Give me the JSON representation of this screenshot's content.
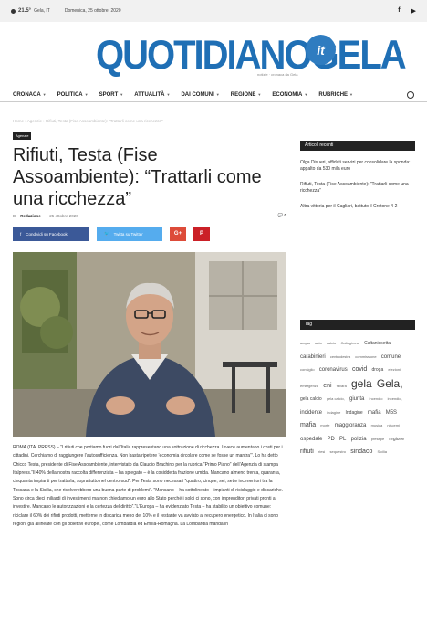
{
  "topbar": {
    "temperature": "21.5°",
    "city": "Gela, IT",
    "date": "Domenica, 25 ottobre, 2020",
    "social_facebook": "f",
    "social_youtube": "▶"
  },
  "logo": {
    "text": "QUOTIDIANOGELA",
    "badge": "it",
    "tagline": "notizie · cronaca da Gela"
  },
  "nav": {
    "items": [
      "CRONACA",
      "POLITICA",
      "SPORT",
      "ATTUALITÀ",
      "DAI COMUNI",
      "REGIONE",
      "ECONOMIA",
      "RUBRICHE"
    ]
  },
  "breadcrumb": "Home  ›  Agenzie  ›  Rifiuti, Testa (Fise Assoambiente): “Trattarli come una ricchezza”",
  "article": {
    "category": "Agenzie",
    "title": "Rifiuti, Testa (Fise Assoambiente): “Trattarli come una ricchezza”",
    "author_prefix": "Di",
    "author": "Redazione",
    "date": "25 ottobre 2020",
    "comments": "0",
    "share_facebook": "Condividi su Facebook",
    "share_twitter": "Twitta su Twitter",
    "share_gplus": "G+",
    "share_pinterest": "P",
    "body": "ROMA (ITALPRESS) – “I rifiuti che portiamo fuori dall’Italia rappresentano una sottrazione di ricchezza. Invece aumentano i costi per i cittadini. Cerchiamo di raggiungere l’autosufficienza. Non basta ripetere ‘economia circolare come se fosse un mantra’”. Lo ha detto Chicco Testa, presidente di Fise Assoambiente, intervistato da Claudio Brachino per la rubrica “Primo Piano” dell’Agenzia di stampa Italpress.“Il 40% della nostra raccolta differenziata – ha spiegato – è la cosiddetta frazione umida. Mancano almeno trenta, quaranta, cinquanta impianti per trattarla, soprattutto nel centro-sud”. Per Testa sono necessari “quattro, cinque, sei, sette inceneritori tra la Toscana e la Sicilia, che risolverebbero una buona parte di problemi”. “Mancano – ha sottolineato – impianti di riciclaggio e discariche. Sono circa dieci miliardi di investimenti ma non chiediamo un euro allo Stato perché i soldi ci sono, con imprenditori privati pronti a investire. Mancano le autorizzazioni e la certezza del diritto”.“L’Europa – ha evidenziato Testa – ha stabilito un obiettivo comune: riciclare il 60% dei rifiuti prodotti, metterne in discarica meno del 10% e il restante va avviato al recupero energetico. In Italia ci sono regioni già allineate con gli obiettivi europei, come Lombardia ed Emilia-Romagna. La Lombardia manda in"
  },
  "sidebar": {
    "recent_title": "Articoli recenti",
    "recent_posts": [
      "Olga Disueri, affidati servizi per consolidare la sponda: appalto da 530 mila euro",
      "Rifiuti, Testa (Fise Assoambiente): “Trattarli come una ricchezza”",
      "Altra vittoria per il Cagliari, battuto il Crotone 4-2"
    ],
    "tag_title": "Tag",
    "tags": [
      {
        "label": "acqua",
        "size": 1
      },
      {
        "label": "auto",
        "size": 1
      },
      {
        "label": "calcio",
        "size": 1
      },
      {
        "label": "Caltagirone",
        "size": 1
      },
      {
        "label": "Caltanissetta",
        "size": 2
      },
      {
        "label": "carabinieri",
        "size": 3
      },
      {
        "label": "centrodestra",
        "size": 1
      },
      {
        "label": "commissione",
        "size": 1
      },
      {
        "label": "comune",
        "size": 3
      },
      {
        "label": "consiglio",
        "size": 1
      },
      {
        "label": "coronavirus",
        "size": 3
      },
      {
        "label": "covid",
        "size": 4
      },
      {
        "label": "droga",
        "size": 2
      },
      {
        "label": "elezioni",
        "size": 1
      },
      {
        "label": "emergenza",
        "size": 1
      },
      {
        "label": "eni",
        "size": 4
      },
      {
        "label": "favara",
        "size": 1
      },
      {
        "label": "gela",
        "size": 5
      },
      {
        "label": "Gela,",
        "size": 5
      },
      {
        "label": "gela calcio",
        "size": 2
      },
      {
        "label": "gela calcio,",
        "size": 1
      },
      {
        "label": "giunta",
        "size": 3
      },
      {
        "label": "incendio",
        "size": 1
      },
      {
        "label": "incendio,",
        "size": 1
      },
      {
        "label": "incidente",
        "size": 3
      },
      {
        "label": "indagine",
        "size": 1
      },
      {
        "label": "Indagine",
        "size": 2
      },
      {
        "label": "mafia",
        "size": 3
      },
      {
        "label": "M5S",
        "size": 3
      },
      {
        "label": "mafia",
        "size": 4
      },
      {
        "label": "morte",
        "size": 1
      },
      {
        "label": "maggioranza",
        "size": 3
      },
      {
        "label": "musica",
        "size": 1
      },
      {
        "label": "niscemi",
        "size": 1
      },
      {
        "label": "ospedale",
        "size": 3
      },
      {
        "label": "PD",
        "size": 3
      },
      {
        "label": "PL",
        "size": 3
      },
      {
        "label": "polizia",
        "size": 3
      },
      {
        "label": "presepe",
        "size": 1
      },
      {
        "label": "regione",
        "size": 2
      },
      {
        "label": "rifiuti",
        "size": 4
      },
      {
        "label": "riesi",
        "size": 1
      },
      {
        "label": "sequestro",
        "size": 1
      },
      {
        "label": "sindaco",
        "size": 4
      },
      {
        "label": "Sicilia",
        "size": 1
      }
    ]
  },
  "colors": {
    "brand_blue": "#1f6fb5",
    "facebook": "#3b5998",
    "twitter": "#55acee",
    "google": "#dd4b39",
    "pinterest": "#cb2027"
  }
}
